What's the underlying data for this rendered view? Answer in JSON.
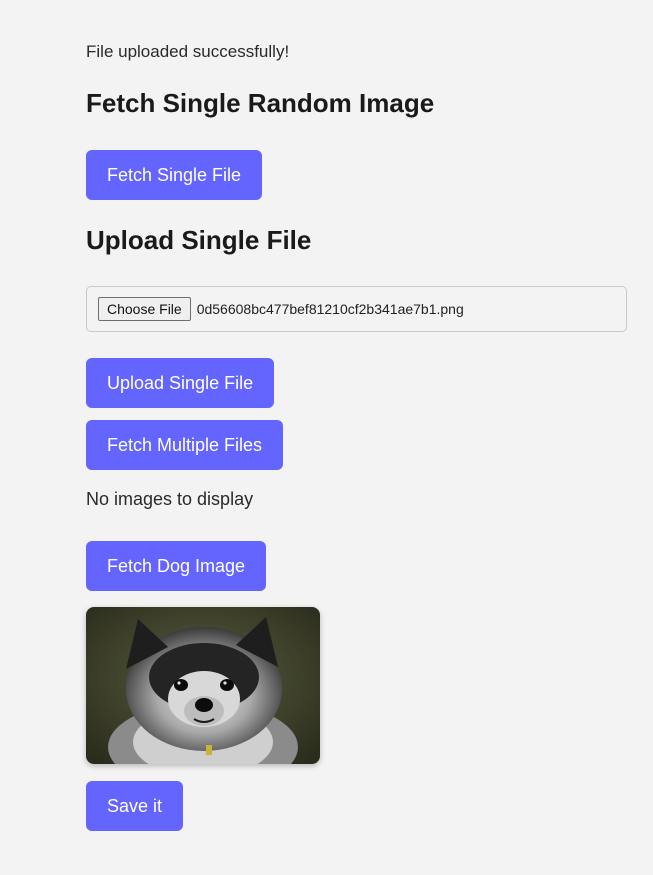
{
  "status_message": "File uploaded successfully!",
  "fetch_single": {
    "heading": "Fetch Single Random Image",
    "button_label": "Fetch Single File"
  },
  "upload_single": {
    "heading": "Upload Single File",
    "choose_file_label": "Choose File",
    "file_name": "0d56608bc477bef81210cf2b341ae7b1.png",
    "upload_button_label": "Upload Single File"
  },
  "fetch_multiple": {
    "button_label": "Fetch Multiple Files",
    "empty_message": "No images to display"
  },
  "dog": {
    "button_label": "Fetch Dog Image",
    "image_subject": "fluffy black and grey puppy",
    "save_button_label": "Save it"
  },
  "colors": {
    "accent": "#6464ff",
    "background": "#f3f3f4"
  }
}
